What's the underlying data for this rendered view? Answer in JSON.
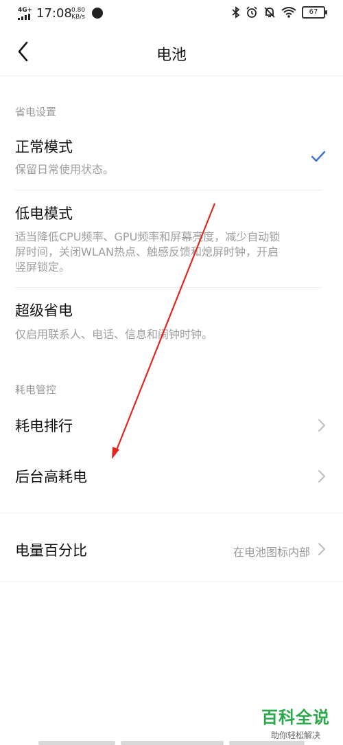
{
  "status_bar": {
    "network": "4G+",
    "time": "17:08",
    "speed_value": "0.80",
    "speed_unit": "KB/s",
    "battery": "67",
    "icons": [
      "bluetooth-icon",
      "alarm-icon",
      "mute-icon",
      "wifi-icon",
      "battery-icon"
    ]
  },
  "header": {
    "title": "电池",
    "back_icon": "chevron-left-icon"
  },
  "sections": [
    {
      "label": "省电设置",
      "items": [
        {
          "title": "正常模式",
          "desc": "保留日常使用状态。",
          "selected": true
        },
        {
          "title": "低电模式",
          "desc": "适当降低CPU频率、GPU频率和屏幕亮度，减少自动锁屏时间，关闭WLAN热点、触感反馈和熄屏时钟，开启竖屏锁定。",
          "selected": false
        },
        {
          "title": "超级省电",
          "desc": "仅启用联系人、电话、信息和闹钟时钟。",
          "selected": false
        }
      ]
    },
    {
      "label": "耗电管控",
      "items": [
        {
          "title": "耗电排行"
        },
        {
          "title": "后台高耗电"
        }
      ]
    }
  ],
  "percentage": {
    "title": "电量百分比",
    "value": "在电池图标内部"
  },
  "watermark": {
    "title": "百科全说",
    "subtitle": "助你轻松解决"
  },
  "colors": {
    "accent": "#3d6fd8",
    "annotation_arrow": "#e0271f",
    "watermark": "#2aa84a"
  }
}
